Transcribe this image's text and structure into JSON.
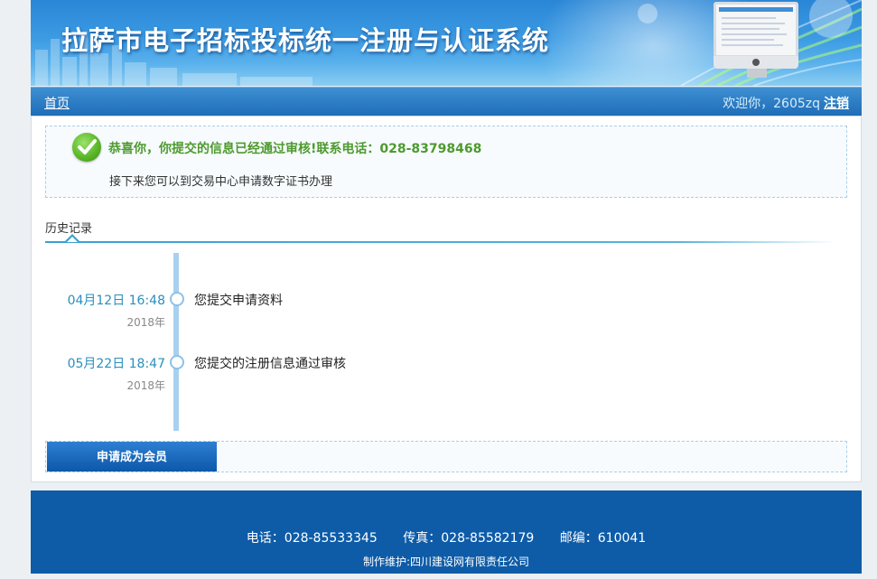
{
  "header": {
    "title": "拉萨市电子招标投标统一注册与认证系统"
  },
  "nav": {
    "home": "首页",
    "welcome": "欢迎你，2605zq",
    "logout": "注销"
  },
  "notice": {
    "icon": "check-circle-icon",
    "message": "恭喜你，你提交的信息已经通过审核!联系电话：028-83798468",
    "sub": "接下来您可以到交易中心申请数字证书办理"
  },
  "history": {
    "title": "历史记录",
    "items": [
      {
        "date": "04月12日 16:48",
        "year": "2018年",
        "text": "您提交申请资料"
      },
      {
        "date": "05月22日 18:47",
        "year": "2018年",
        "text": "您提交的注册信息通过审核"
      }
    ]
  },
  "actions": {
    "apply_member": "申请成为会员"
  },
  "footer": {
    "phone": "电话：028-85533345",
    "fax": "传真：028-85582179",
    "postcode": "邮编：610041",
    "maintainer": "制作维护:四川建设网有限责任公司"
  },
  "colors": {
    "brand_blue": "#1d6cb7",
    "success_green": "#4e9a2e",
    "timeline_blue": "#2a8fbd",
    "footer_blue": "#0e5ca8"
  }
}
